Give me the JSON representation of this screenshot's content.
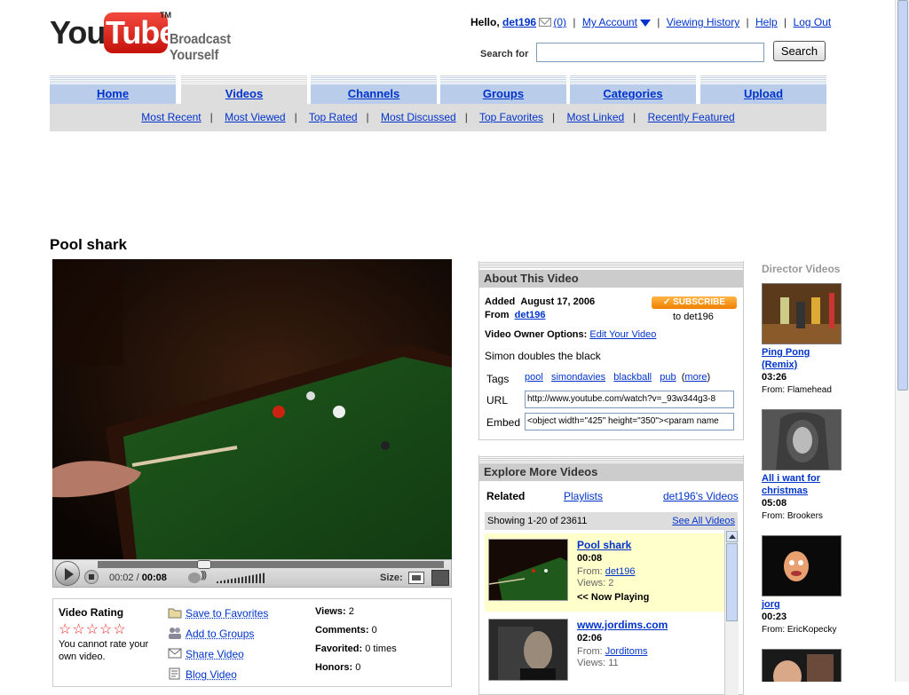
{
  "header": {
    "logo_you": "You",
    "logo_tube": "Tube",
    "logo_tm": "TM",
    "tagline": "Broadcast Yourself",
    "hello": "Hello,",
    "username": "det196",
    "mail_count": "(0)",
    "my_account": "My Account",
    "viewing_history": "Viewing History",
    "help": "Help",
    "logout": "Log Out",
    "search_label": "Search for",
    "search_value": "",
    "search_button": "Search"
  },
  "tabs": [
    {
      "label": "Home"
    },
    {
      "label": "Videos"
    },
    {
      "label": "Channels"
    },
    {
      "label": "Groups"
    },
    {
      "label": "Categories"
    },
    {
      "label": "Upload"
    }
  ],
  "subnav": [
    "Most Recent",
    "Most Viewed",
    "Top Rated",
    "Most Discussed",
    "Top Favorites",
    "Most Linked",
    "Recently Featured"
  ],
  "video": {
    "title": "Pool shark",
    "time_current": "00:02",
    "time_sep": " / ",
    "time_total": "00:08",
    "size_label": "Size:"
  },
  "rating": {
    "heading": "Video Rating",
    "stars": "☆☆☆☆☆",
    "note": "You cannot rate your own video.",
    "actions": [
      "Save to Favorites",
      "Add to Groups",
      "Share Video",
      "Blog Video"
    ],
    "stats": [
      {
        "label": "Views:",
        "value": "2"
      },
      {
        "label": "Comments:",
        "value": "0"
      },
      {
        "label": "Favorited:",
        "value": "0 times"
      },
      {
        "label": "Honors:",
        "value": "0"
      }
    ]
  },
  "about": {
    "heading": "About This Video",
    "added_label": "Added",
    "added_value": "August 17, 2006",
    "from_label": "From",
    "from_value": "det196",
    "subscribe": "SUBSCRIBE",
    "subscribe_to": "to det196",
    "owner_options_label": "Video Owner Options:",
    "edit_video": "Edit Your Video",
    "description": "Simon doubles the black",
    "tags_label": "Tags",
    "tags": [
      "pool",
      "simondavies",
      "blackball",
      "pub"
    ],
    "more": "more",
    "url_label": "URL",
    "url_value": "http://www.youtube.com/watch?v=_93w344g3-8",
    "embed_label": "Embed",
    "embed_value": "<object width=\"425\" height=\"350\"><param name"
  },
  "explore": {
    "heading": "Explore More Videos",
    "tab_related": "Related",
    "tab_playlists": "Playlists",
    "tab_user": "det196's Videos",
    "showing": "Showing 1-20 of 23611",
    "see_all": "See All Videos",
    "items": [
      {
        "title": "Pool shark",
        "duration": "00:08",
        "from_label": "From:",
        "from": "det196",
        "views": "Views: 2",
        "now_playing": "<< Now Playing"
      },
      {
        "title": "www.jordims.com",
        "duration": "02:06",
        "from_label": "From:",
        "from": "Jorditoms",
        "views": "Views: 11"
      }
    ]
  },
  "director": {
    "heading": "Director Videos",
    "items": [
      {
        "title": "Ping Pong (Remix)",
        "duration": "03:26",
        "from": "From: Flamehead"
      },
      {
        "title": "All i want for christmas",
        "duration": "05:08",
        "from": "From: Brookers"
      },
      {
        "title": "jorg",
        "duration": "00:23",
        "from": "From: EricKopecky"
      }
    ]
  }
}
